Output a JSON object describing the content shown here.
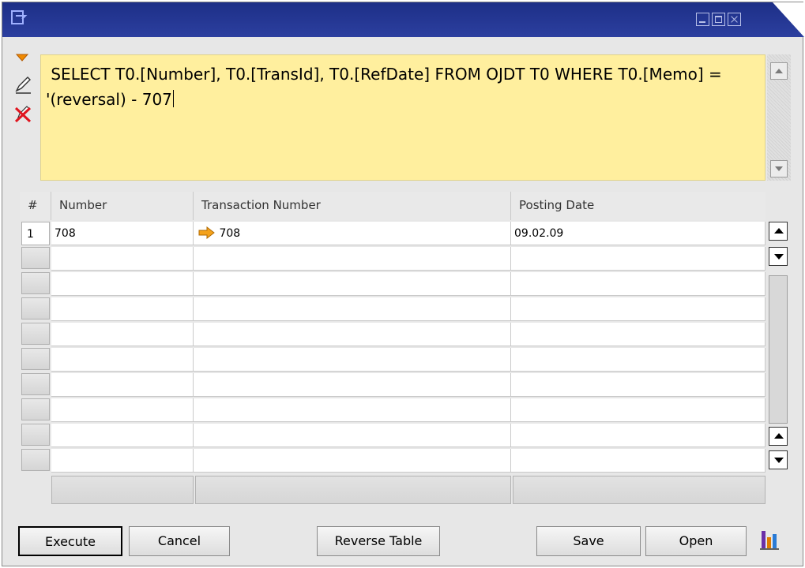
{
  "query": {
    "text": " SELECT T0.[Number], T0.[TransId], T0.[RefDate] FROM OJDT T0 WHERE T0.[Memo] = '(reversal) - 707"
  },
  "table": {
    "columns": [
      "#",
      "Number",
      "Transaction Number",
      "Posting Date"
    ],
    "rows": [
      {
        "index": "1",
        "number": "708",
        "transaction_number": "708",
        "posting_date": "09.02.09"
      }
    ]
  },
  "buttons": {
    "execute": "Execute",
    "cancel": "Cancel",
    "reverse_table": "Reverse Table",
    "save": "Save",
    "open": "Open"
  },
  "colors": {
    "titlebar": "#1d2f87",
    "query_background": "#ffef9e",
    "link_arrow": "#f4a21c"
  },
  "icons": {
    "app": "window-icon",
    "tools": [
      "dropdown-triangle-icon",
      "pencil-icon",
      "delete-icon"
    ],
    "link": "orange-arrow-icon",
    "chart": "bar-chart-icon"
  }
}
